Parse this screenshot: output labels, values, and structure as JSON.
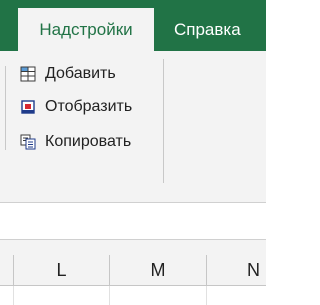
{
  "ribbon_tabs": [
    {
      "label": "Надстройки",
      "active": true
    },
    {
      "label": "Справка",
      "active": false
    }
  ],
  "commands": [
    {
      "label": "Добавить",
      "icon": "add-table-icon"
    },
    {
      "label": "Отобразить",
      "icon": "display-icon"
    },
    {
      "label": "Копировать",
      "icon": "copy-icon"
    }
  ],
  "column_headers": [
    "L",
    "M",
    "N"
  ],
  "colors": {
    "accent": "#217346",
    "ribbon_bg": "#f3f3f3"
  }
}
